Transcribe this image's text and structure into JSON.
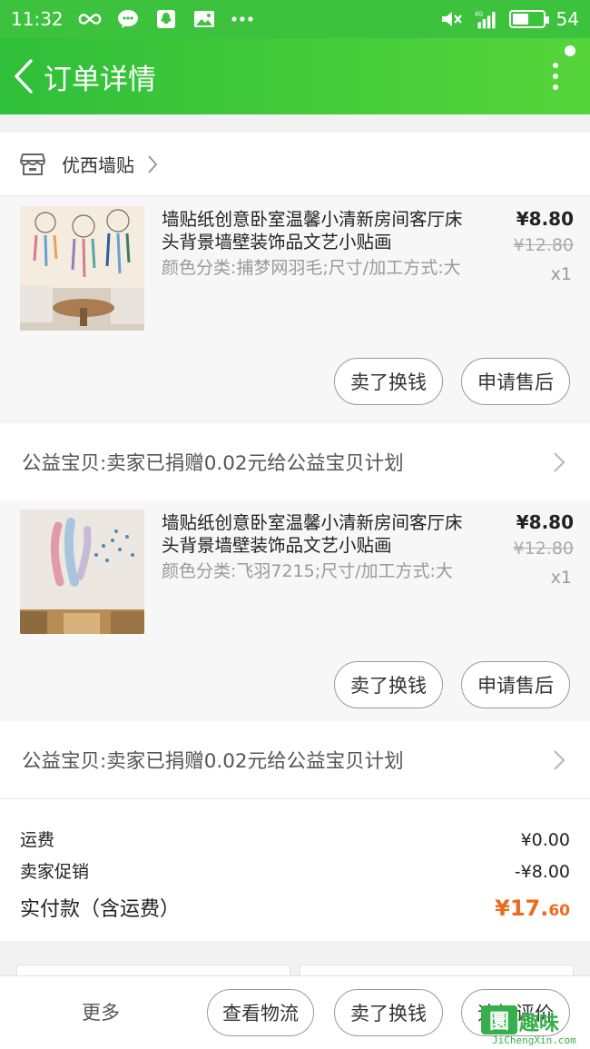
{
  "status_bar": {
    "time": "11:32",
    "battery": "54",
    "battery_fraction": 0.54,
    "network": "4G"
  },
  "header": {
    "title": "订单详情"
  },
  "shop": {
    "name": "优西墙贴"
  },
  "items": [
    {
      "title": "墙贴纸创意卧室温馨小清新房间客厅床头背景墙壁装饰品文艺小贴画",
      "spec": "颜色分类:捕梦网羽毛;尺寸/加工方式:大",
      "price": "¥8.80",
      "original_price": "¥12.80",
      "quantity": "x1",
      "actions": [
        "卖了换钱",
        "申请售后"
      ]
    },
    {
      "title": "墙贴纸创意卧室温馨小清新房间客厅床头背景墙壁装饰品文艺小贴画",
      "spec": "颜色分类:飞羽7215;尺寸/加工方式:大",
      "price": "¥8.80",
      "original_price": "¥12.80",
      "quantity": "x1",
      "actions": [
        "卖了换钱",
        "申请售后"
      ]
    }
  ],
  "charity": [
    "公益宝贝:卖家已捐赠0.02元给公益宝贝计划",
    "公益宝贝:卖家已捐赠0.02元给公益宝贝计划"
  ],
  "summary": {
    "shipping_label": "运费",
    "shipping_value": "¥0.00",
    "promo_label": "卖家促销",
    "promo_value": "-¥8.00",
    "paid_label": "实付款（含运费）",
    "paid_currency": "¥",
    "paid_integer": "17.",
    "paid_decimal": "60"
  },
  "bottom_bar": {
    "more": "更多",
    "logistics": "查看物流",
    "sell": "卖了换钱",
    "review": "追加评价"
  },
  "watermark": {
    "logo_char": "圜",
    "name": "趣味",
    "url": "JiChengXin.com"
  },
  "colors": {
    "header_green": "#3cc23c",
    "price_orange": "#f06a1d"
  }
}
